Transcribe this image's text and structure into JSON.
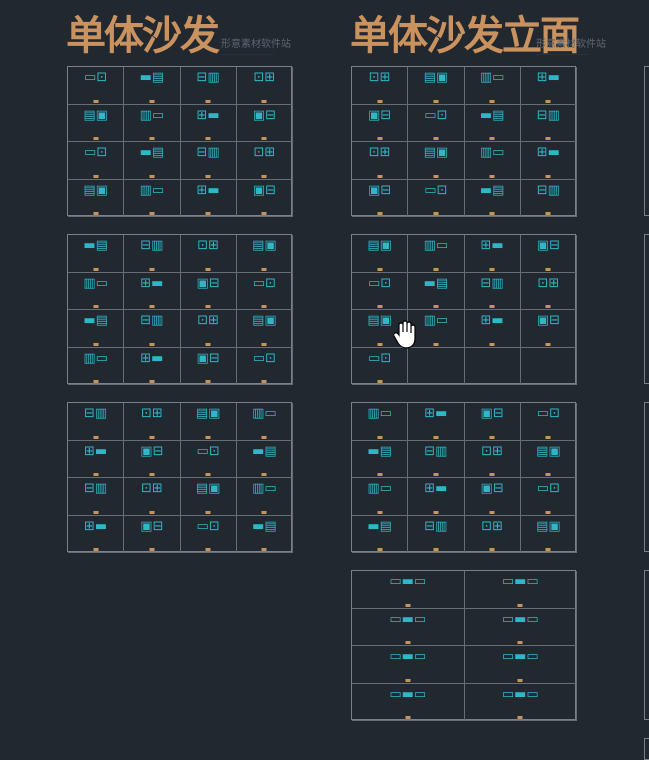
{
  "titles": {
    "left": "单体沙发",
    "right": "单体沙发立面",
    "watermark": "形意素材软件站"
  },
  "icons": {
    "cursor": "hand-pan-cursor-icon",
    "furniture": "sofa-drawing-icon"
  },
  "colors": {
    "background": "#212830",
    "title": "#c9925e",
    "lines": "#2fb7c7",
    "grid": "#676d74"
  }
}
